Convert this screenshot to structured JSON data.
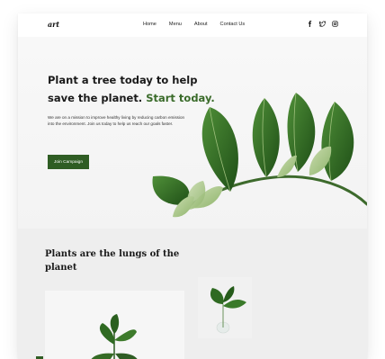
{
  "nav": {
    "logo": "art",
    "links": [
      "Home",
      "Menu",
      "About",
      "Contact Us"
    ],
    "socials": [
      "facebook-icon",
      "twitter-icon",
      "instagram-icon"
    ]
  },
  "hero": {
    "title_main": "Plant a tree today to help save the planet.",
    "title_accent": "Start today.",
    "text": "We are on a mission to improve healthy living by reducing carbon emission into the environment. Join us today to help us reach our goals faster.",
    "button": "Join Campaign"
  },
  "section2": {
    "title": "Plants are the lungs of the planet"
  },
  "colors": {
    "accent": "#3a6b2a",
    "button": "#2f5d24",
    "leaf": "#2f6a22"
  }
}
